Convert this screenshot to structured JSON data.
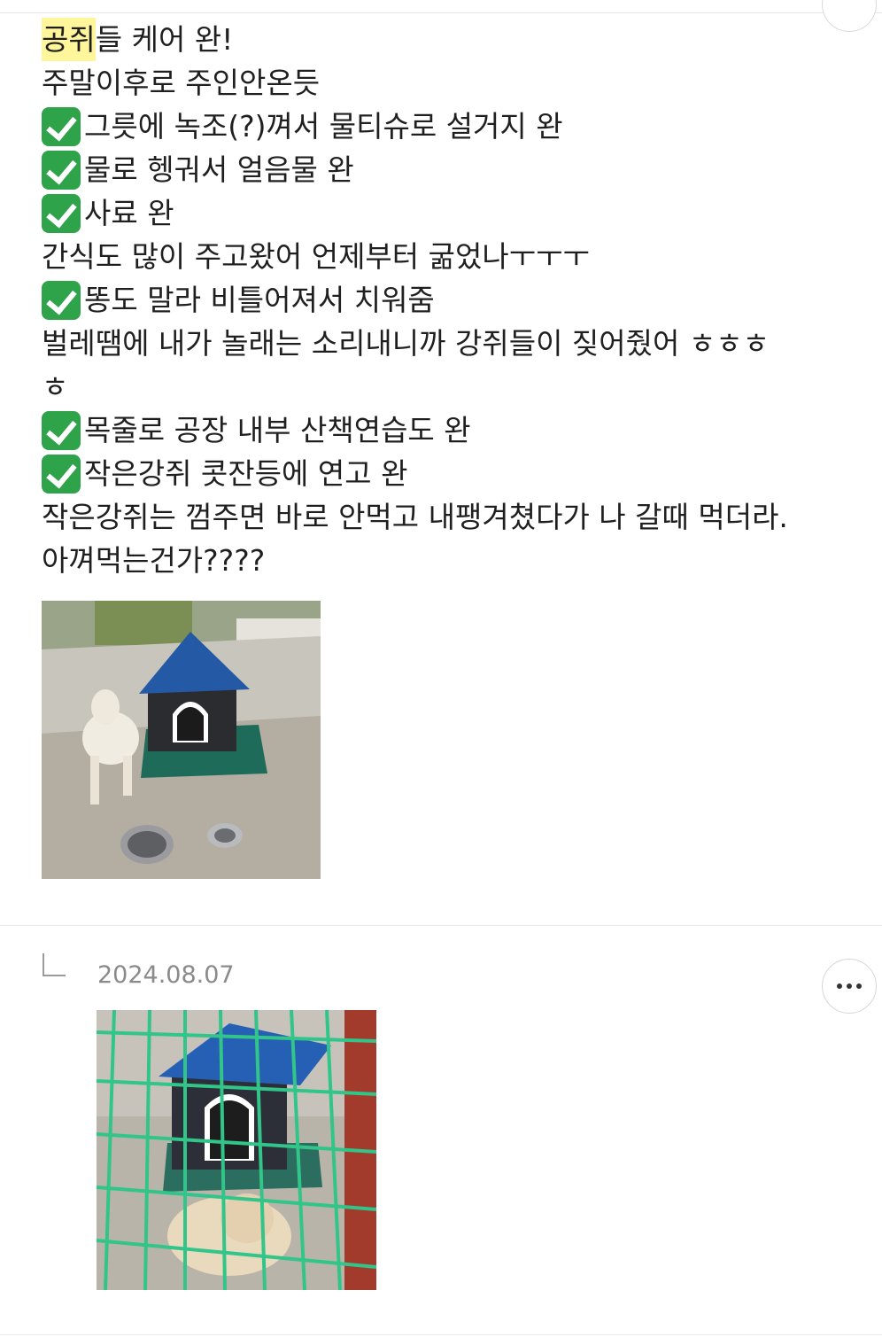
{
  "post": {
    "highlight_word": "공쥐",
    "lines": [
      {
        "check": false,
        "text": "들 케어 완!"
      },
      {
        "check": false,
        "text": "주말이후로 주인안온듯"
      },
      {
        "check": true,
        "text": "그릇에 녹조(?)껴서 물티슈로 설거지 완"
      },
      {
        "check": true,
        "text": "물로 헹궈서 얼음물 완"
      },
      {
        "check": true,
        "text": "사료 완"
      },
      {
        "check": false,
        "text": "간식도 많이 주고왔어 언제부터 굶었나ㅜㅜㅜ"
      },
      {
        "check": true,
        "text": "똥도 말라 비틀어져서 치워줌"
      },
      {
        "check": false,
        "text": "벌레땜에 내가 놀래는 소리내니까 강쥐들이 짖어줬어 ㅎㅎㅎ"
      },
      {
        "check": false,
        "text": "ㅎ"
      },
      {
        "check": true,
        "text": "목줄로 공장 내부 산책연습도 완"
      },
      {
        "check": true,
        "text": "작은강쥐 콧잔등에 연고 완"
      },
      {
        "check": false,
        "text": "작은강쥐는 껌주면 바로 안먹고 내팽겨쳤다가 나 갈때 먹더라."
      },
      {
        "check": false,
        "text": "아껴먹는건가????"
      }
    ]
  },
  "comment": {
    "date": "2024.08.07",
    "more_label": "more"
  },
  "icons": {
    "check": "check-mark-button-icon",
    "reply": "reply-arrow-icon",
    "more": "more-dots-icon"
  },
  "colors": {
    "highlight": "#fff59a",
    "check_green": "#2fa34a",
    "date_gray": "#8a8a8a"
  }
}
